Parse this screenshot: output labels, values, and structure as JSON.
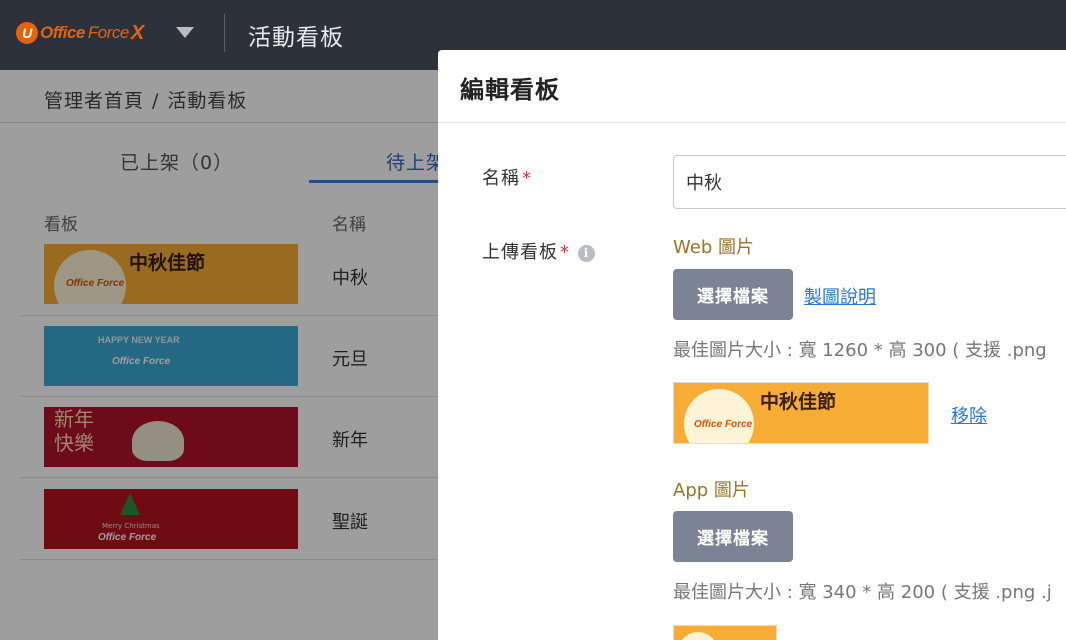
{
  "topbar": {
    "brand": {
      "mark": "U",
      "office": "Office",
      "force": "Force",
      "x": "X"
    },
    "title": "活動看板"
  },
  "breadcrumb": {
    "home": "管理者首頁",
    "separator": "/",
    "current": "活動看板"
  },
  "tabs": [
    {
      "label": "已上架（0）",
      "active": false
    },
    {
      "label": "待上架",
      "active": true
    }
  ],
  "table": {
    "headers": {
      "banner": "看板",
      "name": "名稱"
    },
    "rows": [
      {
        "name": "中秋",
        "banner_text": "中秋佳節",
        "banner_theme": "mid-autumn"
      },
      {
        "name": "元旦",
        "banner_text": "HAPPY NEW YEAR",
        "banner_theme": "new-year"
      },
      {
        "name": "新年",
        "banner_text": "新年快樂",
        "banner_theme": "lunar-new-year"
      },
      {
        "name": "聖誕",
        "banner_text": "Merry Christmas",
        "banner_theme": "christmas"
      }
    ]
  },
  "modal": {
    "title": "編輯看板",
    "name_label": "名稱",
    "required_mark": "*",
    "name_value": "中秋",
    "upload_label": "上傳看板",
    "info_icon": "i",
    "web": {
      "label": "Web 圖片",
      "choose_button": "選擇檔案",
      "guide_link": "製圖說明",
      "hint": "最佳圖片大小 : 寬 1260 * 高 300 ( 支援 .png",
      "remove_link": "移除",
      "preview_text": "中秋佳節"
    },
    "app": {
      "label": "App 圖片",
      "choose_button": "選擇檔案",
      "hint": "最佳圖片大小 : 寬 340 * 高 200 ( 支援 .png .j"
    }
  },
  "banner_brand": "Office Force",
  "colors": {
    "topbar": "#2c313c",
    "brand_orange": "#e8620c",
    "accent_blue": "#3a7bd5",
    "button_gray": "#7b8394",
    "required_red": "#e0303c",
    "sub_label_gold": "#9a7428"
  }
}
